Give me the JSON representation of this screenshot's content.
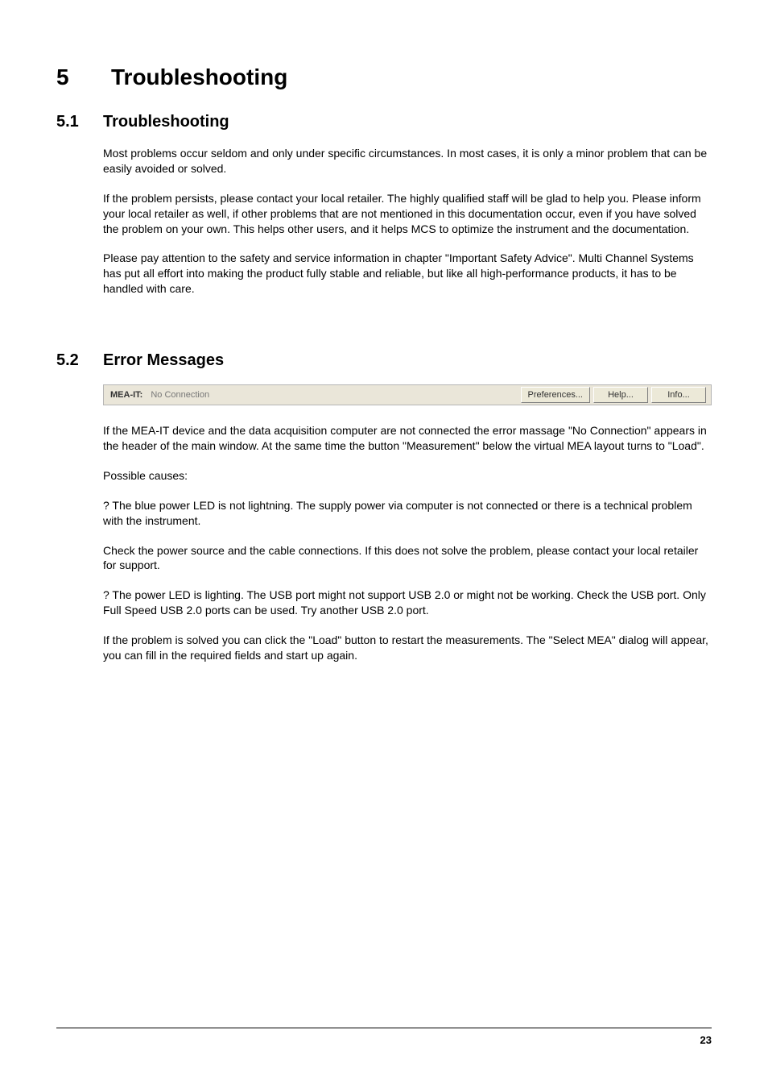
{
  "chapter": {
    "number": "5",
    "title": "Troubleshooting"
  },
  "section1": {
    "number": "5.1",
    "title": "Troubleshooting",
    "p1": "Most problems occur seldom and only under specific circumstances. In most cases, it is only a minor problem that can be easily avoided or solved.",
    "p2": "If the problem persists, please contact your local retailer. The highly qualified staff will be glad to help you. Please inform your local retailer as well, if other problems that are not mentioned in this documentation occur, even if you have solved the problem on your own. This helps other users, and it helps MCS to optimize the instrument and the documentation.",
    "p3": "Please pay attention to the safety and service information in chapter \"Important Safety Advice\". Multi Channel Systems has put all effort into making the product fully stable and reliable, but like all high-performance products, it has to be handled with care."
  },
  "section2": {
    "number": "5.2",
    "title": "Error Messages",
    "toolbar": {
      "app_label": "MEA-IT:",
      "status": "No Connection",
      "buttons": {
        "preferences": "Preferences...",
        "help": "Help...",
        "info": "Info..."
      }
    },
    "p1": "If the MEA-IT device and the data acquisition computer are not connected the error massage \"No Connection\" appears in the header of the main window. At the same time the button \"Measurement\" below the virtual MEA layout turns to \"Load\".",
    "p2": "Possible causes:",
    "p3": "? The blue power LED is not lightning. The supply power via computer is not connected or there is a technical problem with the instrument.",
    "p4": "Check the power source and the cable connections. If this does not solve the problem, please contact your local retailer for support.",
    "p5": "? The power LED is lighting. The USB port might not support USB 2.0 or might not be working. Check the USB port. Only Full Speed USB 2.0 ports can be used. Try another USB 2.0 port.",
    "p6": "If the problem is solved you can click the \"Load\" button to restart the measurements. The \"Select MEA\" dialog will appear, you can fill in the required fields and start up again."
  },
  "page_number": "23"
}
